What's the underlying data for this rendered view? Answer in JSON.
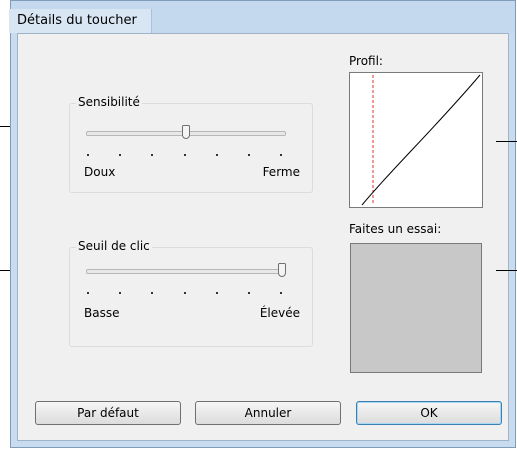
{
  "window": {
    "title": "Détails du toucher"
  },
  "sensitivity": {
    "label": "Sensibilité",
    "min_label": "Doux",
    "max_label": "Ferme",
    "value_fraction": 0.5
  },
  "click_threshold": {
    "label": "Seuil de clic",
    "min_label": "Basse",
    "max_label": "Élevée",
    "value_fraction": 1.0
  },
  "profile": {
    "label": "Profil:"
  },
  "test_area": {
    "label": "Faites un essai:"
  },
  "buttons": {
    "default": "Par défaut",
    "cancel": "Annuler",
    "ok": "OK"
  },
  "colors": {
    "profile_marker": "#e03030",
    "test_area_fill": "#c8c8c8"
  }
}
